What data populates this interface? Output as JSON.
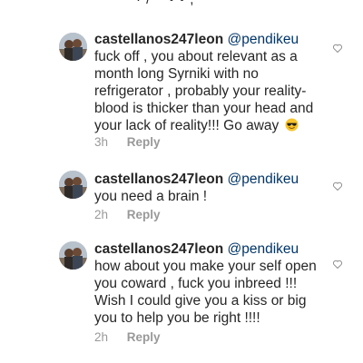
{
  "top_fragment": "· / ~ • • ,",
  "comments": [
    {
      "username": "castellanos247leon",
      "mention": "@pendikeu",
      "text": " fuck off , you about relevant as a month long Syrniki with no refrigerator , probably your reality- blood is thicker than your head and your lack of reality!!! Go away",
      "emoji": "smiling-face-with-sunglasses",
      "time": "3h",
      "reply_label": "Reply"
    },
    {
      "username": "castellanos247leon",
      "mention": "@pendikeu",
      "text": " you need a brain !",
      "time": "2h",
      "reply_label": "Reply"
    },
    {
      "username": "castellanos247leon",
      "mention": "@pendikeu",
      "text": " how about you make your self open you coward , fuck  you inbreed !!! Wish I could give you a kiss or big you to help you be right !!!!",
      "time": "2h",
      "reply_label": "Reply"
    }
  ],
  "colors": {
    "text": "#262626",
    "mention": "#003569",
    "meta": "#999999",
    "like_outline": "#8e8e8e"
  },
  "icons": {
    "like": "heart-outline-icon",
    "emoji": "smiling-face-with-sunglasses"
  }
}
